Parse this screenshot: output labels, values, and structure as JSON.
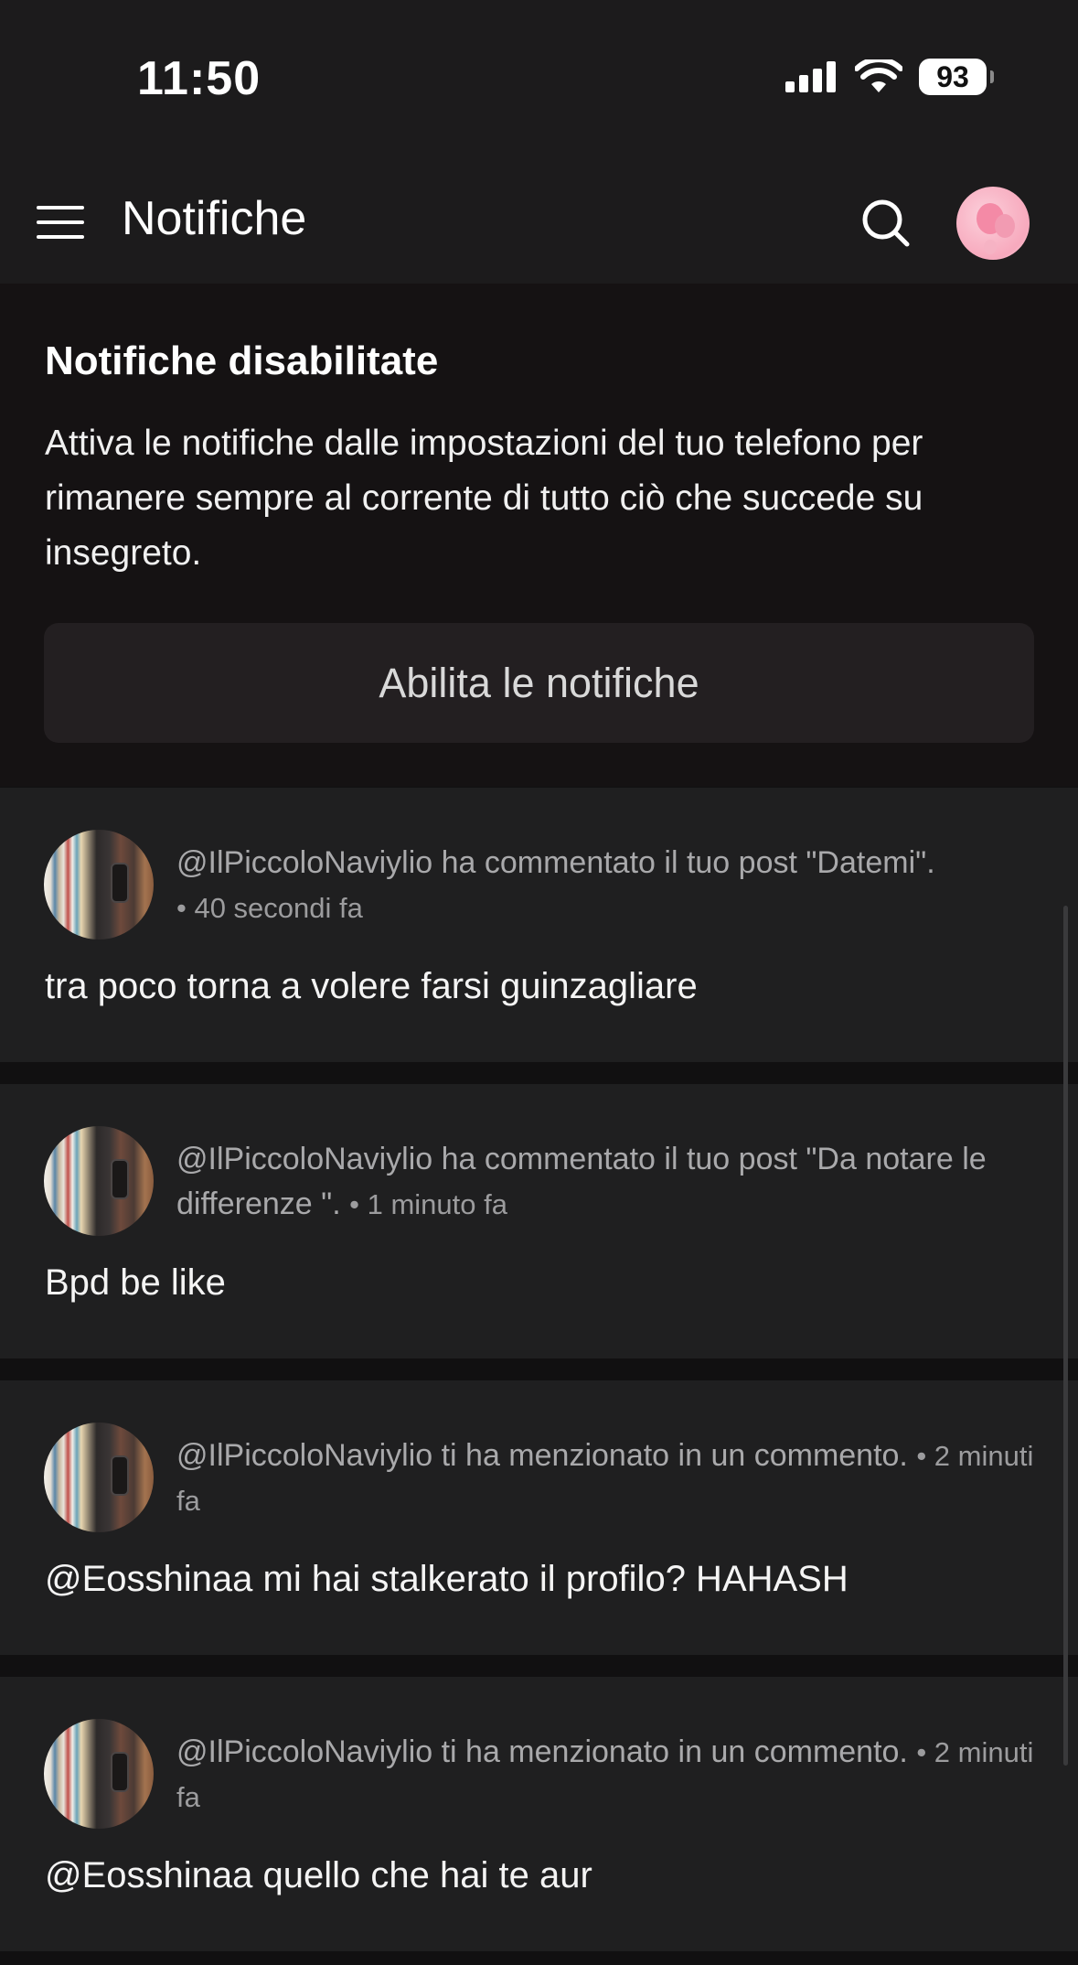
{
  "status_bar": {
    "time": "11:50",
    "battery": "93",
    "icons": [
      "cellular-signal-icon",
      "wifi-icon",
      "battery-icon"
    ]
  },
  "header": {
    "title": "Notifiche",
    "icons": [
      "menu-icon",
      "search-icon",
      "avatar"
    ]
  },
  "banner": {
    "title": "Notifiche disabilitate",
    "text": "Attiva le notifiche dalle impostazioni del tuo telefono per rimanere sempre al corrente di tutto ciò che succede su insegreto.",
    "button_label": "Abilita le notifiche"
  },
  "notifications": [
    {
      "action": "@IlPiccoloNaviylio ha commentato il tuo post \"Datemi\".",
      "time": "• 40 secondi fa",
      "content": "tra poco torna a volere farsi guinzagliare"
    },
    {
      "action": "@IlPiccoloNaviylio ha commentato il tuo post \"Da notare le differenze \".",
      "time": "• 1 minuto fa",
      "content": "Bpd be like"
    },
    {
      "action": "@IlPiccoloNaviylio ti ha menzionato in un commento.",
      "time": "• 2 minuti fa",
      "content": "@Eosshinaa mi hai stalkerato il profilo? HAHASH"
    },
    {
      "action": "@IlPiccoloNaviylio ti ha menzionato in un commento.",
      "time": "• 2 minuti fa",
      "content": "@Eosshinaa quello che hai te aur"
    }
  ],
  "colors": {
    "background": "#111011",
    "bar": "#1c1b1c",
    "banner": "#151213",
    "card": "#1f1f20",
    "button": "#231f21",
    "meta_text": "#a9a9ab"
  }
}
